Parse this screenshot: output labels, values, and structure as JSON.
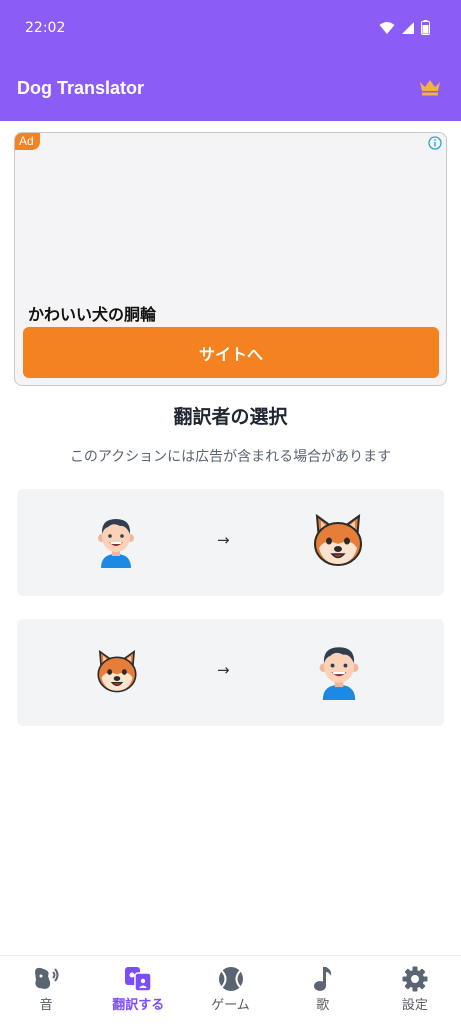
{
  "status": {
    "time": "22:02"
  },
  "appbar": {
    "title": "Dog Translator",
    "premium_icon": "crown-icon"
  },
  "ad": {
    "badge": "Ad",
    "headline": "かわいい犬の胴輪",
    "cta": "サイトへ"
  },
  "section": {
    "title": "翻訳者の選択",
    "subtitle": "このアクションには広告が含まれる場合があります"
  },
  "options": [
    {
      "from": "human-face-icon",
      "to": "dog-face-icon",
      "arrow": "→"
    },
    {
      "from": "dog-face-icon",
      "to": "human-face-icon",
      "arrow": "→"
    }
  ],
  "nav": {
    "items": [
      {
        "label": "音",
        "icon": "sound-icon",
        "active": false
      },
      {
        "label": "翻訳する",
        "icon": "translate-icon",
        "active": true
      },
      {
        "label": "ゲーム",
        "icon": "ball-icon",
        "active": false
      },
      {
        "label": "歌",
        "icon": "music-note-icon",
        "active": false
      },
      {
        "label": "設定",
        "icon": "gear-icon",
        "active": false
      }
    ]
  },
  "colors": {
    "primary": "#8b5cf6",
    "accent": "#f58220",
    "active_nav": "#7c4dff"
  }
}
